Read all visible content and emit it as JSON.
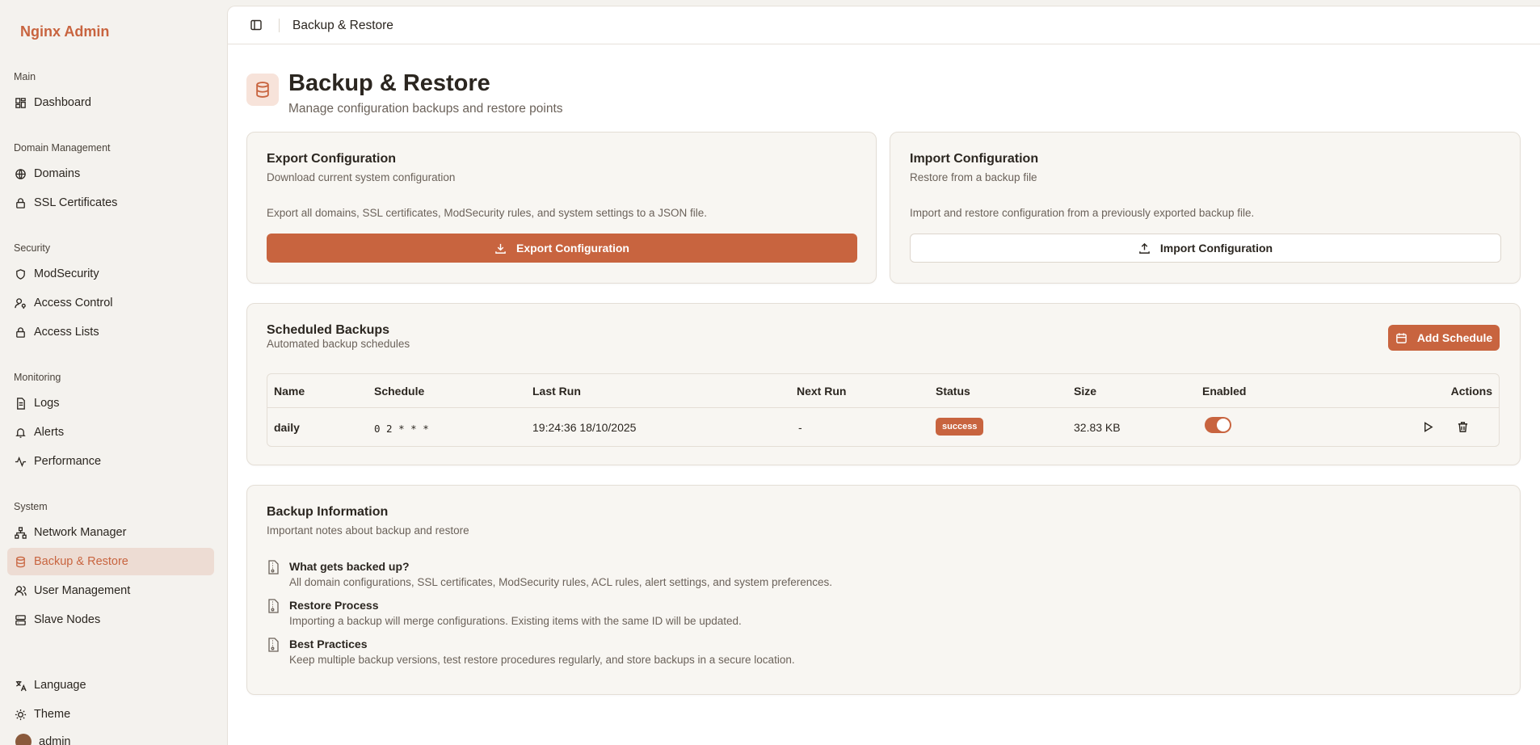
{
  "app": {
    "brand": "Nginx Admin"
  },
  "sidebar": {
    "sections": {
      "main": "Main",
      "domain_management": "Domain Management",
      "security": "Security",
      "monitoring": "Monitoring",
      "system": "System"
    },
    "items": {
      "dashboard": "Dashboard",
      "domains": "Domains",
      "ssl": "SSL Certificates",
      "modsecurity": "ModSecurity",
      "access_control": "Access Control",
      "access_lists": "Access Lists",
      "logs": "Logs",
      "alerts": "Alerts",
      "performance": "Performance",
      "network_manager": "Network Manager",
      "backup_restore": "Backup & Restore",
      "user_management": "User Management",
      "slave_nodes": "Slave Nodes",
      "language": "Language",
      "theme": "Theme"
    },
    "user": {
      "name": "admin"
    }
  },
  "header": {
    "breadcrumb": "Backup & Restore"
  },
  "page": {
    "title": "Backup & Restore",
    "subtitle": "Manage configuration backups and restore points"
  },
  "export_card": {
    "title": "Export Configuration",
    "description": "Download current system configuration",
    "text": "Export all domains, SSL certificates, ModSecurity rules, and system settings to a JSON file.",
    "button": "Export Configuration"
  },
  "import_card": {
    "title": "Import Configuration",
    "description": "Restore from a backup file",
    "text": "Import and restore configuration from a previously exported backup file.",
    "button": "Import Configuration"
  },
  "scheduled": {
    "title": "Scheduled Backups",
    "description": "Automated backup schedules",
    "add_button": "Add Schedule",
    "columns": {
      "name": "Name",
      "schedule": "Schedule",
      "last_run": "Last Run",
      "next_run": "Next Run",
      "status": "Status",
      "size": "Size",
      "enabled": "Enabled",
      "actions": "Actions"
    },
    "rows": [
      {
        "name": "daily",
        "schedule": "0 2 * * *",
        "last_run": "19:24:36 18/10/2025",
        "next_run": "-",
        "status": "success",
        "size": "32.83 KB",
        "enabled": true
      }
    ]
  },
  "info": {
    "title": "Backup Information",
    "description": "Important notes about backup and restore",
    "items": [
      {
        "title": "What gets backed up?",
        "text": "All domain configurations, SSL certificates, ModSecurity rules, ACL rules, alert settings, and system preferences."
      },
      {
        "title": "Restore Process",
        "text": "Importing a backup will merge configurations. Existing items with the same ID will be updated."
      },
      {
        "title": "Best Practices",
        "text": "Keep multiple backup versions, test restore procedures regularly, and store backups in a secure location."
      }
    ]
  },
  "colors": {
    "accent": "#c8643f",
    "background": "#f4f2ee",
    "card": "#f8f6f2"
  }
}
